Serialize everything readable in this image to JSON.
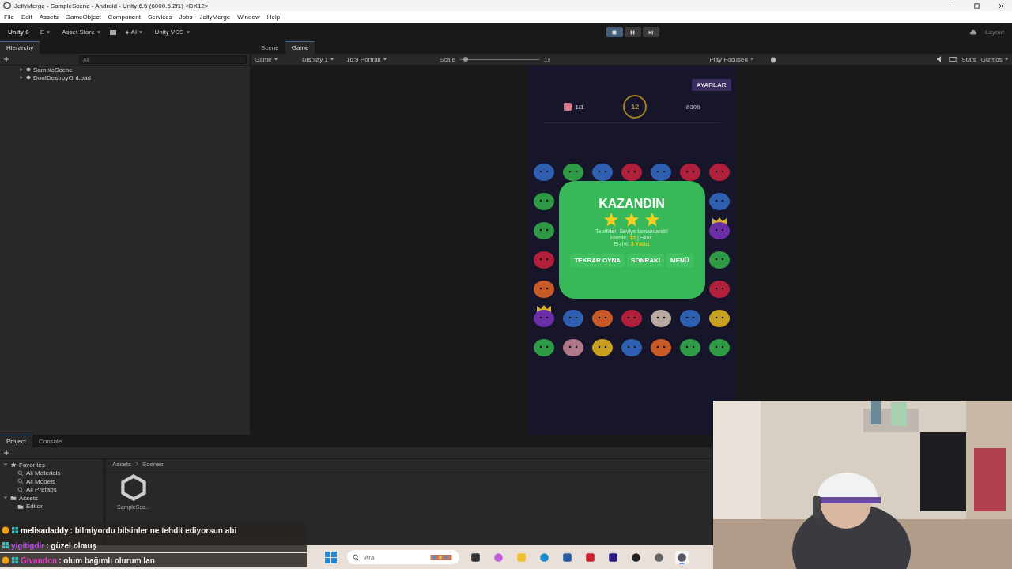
{
  "window": {
    "title": "JellyMerge - SampleScene - Android - Unity 6.5 (6000.5.2f1) <DX12>"
  },
  "menu": [
    "File",
    "Edit",
    "Assets",
    "GameObject",
    "Component",
    "Services",
    "Jobs",
    "JellyMerge",
    "Window",
    "Help"
  ],
  "toolbar": {
    "account": "Unity 6",
    "user": "E",
    "asset_store": "Asset Store",
    "ai": "AI",
    "vcs": "Unity VCS",
    "layout": "Layout",
    "play_buttons": [
      {
        "kind": "stop",
        "selected": true
      },
      {
        "kind": "pause",
        "selected": false
      },
      {
        "kind": "step",
        "selected": false
      }
    ]
  },
  "hierarchy": {
    "tab": "Hierarchy",
    "search": {
      "placeholder": "All"
    },
    "items": [
      {
        "label": "SampleScene"
      },
      {
        "label": "DontDestroyOnLoad"
      }
    ]
  },
  "view_tabs": [
    {
      "label": "Scene",
      "selected": false
    },
    {
      "label": "Game",
      "selected": true
    }
  ],
  "game_toolbar": {
    "mode": "Game",
    "display": "Display 1",
    "aspect": "16:9 Portrait",
    "scale_label": "Scale",
    "scale": {
      "level": 0.04
    },
    "scale_value": "1x",
    "play_focused": "Play Focused",
    "stats": "Stats",
    "gizmos": "Gizmos"
  },
  "game": {
    "settings_button": "AYARLAR",
    "goal": "1/1",
    "moves": "12",
    "score": "8300",
    "board": [
      {
        "color": "#2f5fb0",
        "kind": "plain"
      },
      {
        "color": "#2f9a45",
        "kind": "plain"
      },
      {
        "color": "#2f5fb0",
        "kind": "plain"
      },
      {
        "color": "#b0203a",
        "kind": "plain"
      },
      {
        "color": "#2f5fb0",
        "kind": "plain"
      },
      {
        "color": "#b0203a",
        "kind": "plain"
      },
      {
        "color": "#b0203a",
        "kind": "plain"
      },
      {
        "color": "#2f9a45",
        "kind": "plain"
      },
      {
        "color": "#2f5fb0",
        "kind": "plain"
      },
      {
        "color": "#2f9a45",
        "kind": "plain"
      },
      {
        "color": "#6a2fa8",
        "kind": "crown"
      },
      {
        "color": "#b0203a",
        "kind": "plain"
      },
      {
        "color": "#2f9a45",
        "kind": "plain"
      },
      {
        "color": "#c85a25",
        "kind": "plain"
      },
      {
        "color": "#b0203a",
        "kind": "plain"
      },
      {
        "color": "#6a2fa8",
        "kind": "crown"
      },
      {
        "color": "#2f5fb0",
        "kind": "plain"
      },
      {
        "color": "#c85a25",
        "kind": "plain"
      },
      {
        "color": "#b0203a",
        "kind": "plain"
      },
      {
        "color": "#b8aaa0",
        "kind": "plain"
      },
      {
        "color": "#2f5fb0",
        "kind": "plain"
      },
      {
        "color": "#c8a020",
        "kind": "plain"
      },
      {
        "color": "#2f9a45",
        "kind": "plain"
      },
      {
        "color": "#b07888",
        "kind": "plain"
      },
      {
        "color": "#c8a020",
        "kind": "plain"
      },
      {
        "color": "#2f5fb0",
        "kind": "plain"
      },
      {
        "color": "#c85a25",
        "kind": "plain"
      },
      {
        "color": "#2f9a45",
        "kind": "plain"
      },
      {
        "color": "#2f9a45",
        "kind": "plain"
      }
    ],
    "popup": {
      "title": "KAZANDIN",
      "stars": 3,
      "message": "Tebrikler! Seviye tamamlandı!",
      "moves_label": "Hamle:",
      "moves": "12",
      "score_label": "| Skor:",
      "best_label": "En İyi:",
      "best": "3 Yıldız",
      "buttons": [
        "TEKRAR OYNA",
        "SONRAKİ",
        "MENÜ"
      ]
    }
  },
  "project": {
    "tabs": [
      {
        "label": "Project",
        "selected": true
      },
      {
        "label": "Console",
        "selected": false
      }
    ],
    "tree": [
      {
        "label": "Favorites",
        "kind": "favorites",
        "expanded": true,
        "children": [
          {
            "label": "All Materials"
          },
          {
            "label": "All Models"
          },
          {
            "label": "All Prefabs"
          }
        ]
      },
      {
        "label": "Assets",
        "kind": "folder",
        "expanded": true,
        "children": [
          {
            "label": "Editor"
          }
        ]
      }
    ],
    "breadcrumb": [
      "Assets",
      "Scenes"
    ],
    "files": [
      {
        "label": "SampleSce..."
      }
    ]
  },
  "chat": [
    {
      "user": "melisadaddy",
      "text": ": bilmiyordu bilsinler ne tehdit ediyorsun abi",
      "color": "#ffffff",
      "badge": true
    },
    {
      "user": "yigitigdir",
      "text": ": güzel olmuş",
      "color": "#b44ce0",
      "badge": false
    },
    {
      "user": "Givandon",
      "text": ": olum bağımlı olurum lan",
      "color": "#e040c0",
      "badge": true
    }
  ],
  "taskbar": {
    "search": {
      "placeholder": "Ara"
    },
    "apps": [
      {
        "kind": "taskview",
        "selected": false
      },
      {
        "kind": "copilot",
        "selected": false
      },
      {
        "kind": "explorer",
        "selected": false
      },
      {
        "kind": "edge",
        "selected": false
      },
      {
        "kind": "store",
        "selected": false
      },
      {
        "kind": "vivaldi",
        "selected": false
      },
      {
        "kind": "premiere",
        "selected": false
      },
      {
        "kind": "obs",
        "selected": false
      },
      {
        "kind": "hub",
        "selected": false
      },
      {
        "kind": "unity",
        "selected": true
      }
    ]
  }
}
